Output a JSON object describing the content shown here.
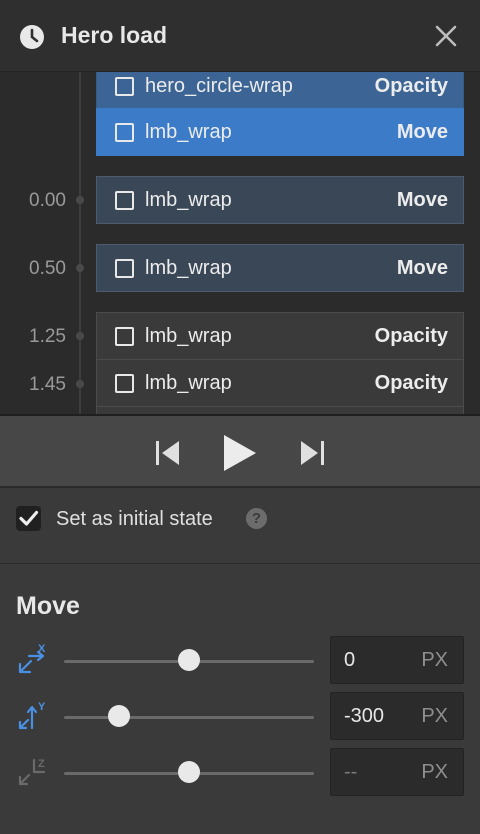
{
  "header": {
    "title": "Hero load",
    "icon": "clock-icon"
  },
  "timeline": {
    "times": [
      "0.00",
      "0.50",
      "1.25",
      "1.45"
    ],
    "items": [
      {
        "name": "hero_circle-wrap",
        "action": "Opacity"
      },
      {
        "name": "lmb_wrap",
        "action": "Move"
      },
      {
        "name": "lmb_wrap",
        "action": "Move"
      },
      {
        "name": "lmb_wrap",
        "action": "Move"
      },
      {
        "name": "lmb_wrap",
        "action": "Opacity"
      },
      {
        "name": "lmb_wrap",
        "action": "Opacity"
      }
    ]
  },
  "controls": {
    "prev": "skip-back-icon",
    "play": "play-icon",
    "next": "skip-forward-icon"
  },
  "initial_state": {
    "label": "Set as initial state",
    "checked": true,
    "help": "?"
  },
  "move": {
    "heading": "Move",
    "x": {
      "value": "0",
      "placeholder": "",
      "unit": "PX",
      "slider": 0.5
    },
    "y": {
      "value": "-300",
      "placeholder": "",
      "unit": "PX",
      "slider": 0.22
    },
    "z": {
      "value": "",
      "placeholder": "--",
      "unit": "PX",
      "slider": 0.5
    }
  },
  "colors": {
    "selected": "#3c7bc8",
    "accent_axis": "#4a90e2"
  }
}
